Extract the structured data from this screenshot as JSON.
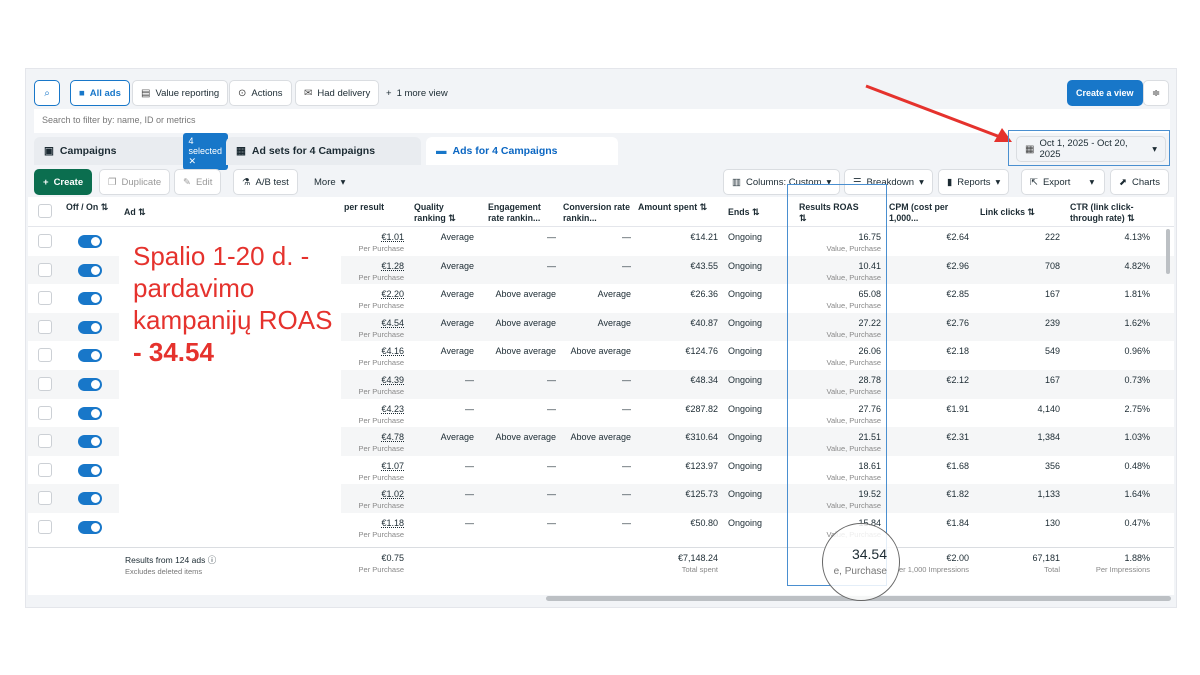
{
  "toolbar": {
    "all_ads": "All ads",
    "value_reporting": "Value reporting",
    "actions": "Actions",
    "had_delivery": "Had delivery",
    "more_view": "1 more view",
    "create_view": "Create a view"
  },
  "search": {
    "placeholder": "Search to filter by: name, ID or metrics"
  },
  "tabs": {
    "campaigns": "Campaigns",
    "selected": "4 selected",
    "adsets": "Ad sets for 4 Campaigns",
    "ads": "Ads for 4 Campaigns"
  },
  "date_range": "Oct 1, 2025 - Oct 20, 2025",
  "actions": {
    "create": "Create",
    "duplicate": "Duplicate",
    "edit": "Edit",
    "ab_test": "A/B test",
    "more": "More",
    "columns": "Columns: Custom",
    "breakdown": "Breakdown",
    "reports": "Reports",
    "export": "Export",
    "charts": "Charts"
  },
  "headers": {
    "offon": "Off / On ⇅",
    "ad": "Ad ⇅",
    "per_result": "per result",
    "quality": "Quality ranking ⇅",
    "engagement": "Engagement rate rankin...",
    "conversion": "Conversion rate rankin...",
    "amount": "Amount spent ⇅",
    "ends": "Ends ⇅",
    "roas": "Results ROAS ⇅",
    "cpm": "CPM (cost per 1,000...",
    "clicks": "Link clicks ⇅",
    "ctr": "CTR (link click-through rate) ⇅"
  },
  "rows": [
    [
      "€1.01",
      "Average",
      "—",
      "—",
      "€14.21",
      "Ongoing",
      "16.75",
      "€2.64",
      "222",
      "4.13%"
    ],
    [
      "€1.28",
      "Average",
      "—",
      "—",
      "€43.55",
      "Ongoing",
      "10.41",
      "€2.96",
      "708",
      "4.82%"
    ],
    [
      "€2.20",
      "Average",
      "Above average",
      "Average",
      "€26.36",
      "Ongoing",
      "65.08",
      "€2.85",
      "167",
      "1.81%"
    ],
    [
      "€4.54",
      "Average",
      "Above average",
      "Average",
      "€40.87",
      "Ongoing",
      "27.22",
      "€2.76",
      "239",
      "1.62%"
    ],
    [
      "€4.16",
      "Average",
      "Above average",
      "Above average",
      "€124.76",
      "Ongoing",
      "26.06",
      "€2.18",
      "549",
      "0.96%"
    ],
    [
      "€4.39",
      "—",
      "—",
      "—",
      "€48.34",
      "Ongoing",
      "28.78",
      "€2.12",
      "167",
      "0.73%"
    ],
    [
      "€4.23",
      "—",
      "—",
      "—",
      "€287.82",
      "Ongoing",
      "27.76",
      "€1.91",
      "4,140",
      "2.75%"
    ],
    [
      "€4.78",
      "Average",
      "Above average",
      "Above average",
      "€310.64",
      "Ongoing",
      "21.51",
      "€2.31",
      "1,384",
      "1.03%"
    ],
    [
      "€1.07",
      "—",
      "—",
      "—",
      "€123.97",
      "Ongoing",
      "18.61",
      "€1.68",
      "356",
      "0.48%"
    ],
    [
      "€1.02",
      "—",
      "—",
      "—",
      "€125.73",
      "Ongoing",
      "19.52",
      "€1.82",
      "1,133",
      "1.64%"
    ],
    [
      "€1.18",
      "—",
      "—",
      "—",
      "€50.80",
      "Ongoing",
      "15.84",
      "€1.84",
      "130",
      "0.47%"
    ]
  ],
  "row_sub": {
    "per_result": "Per Purchase",
    "roas": "Value, Purchase"
  },
  "footer": {
    "results": "Results from 124 ads",
    "excludes": "Excludes deleted items",
    "per_result": "€0.75",
    "per_result_sub": "Per Purchase",
    "amount": "€7,148.24",
    "amount_sub": "Total spent",
    "roas": "34.54",
    "roas_sub": "e, Purchase",
    "cpm": "€2.00",
    "cpm_sub": "er 1,000 Impressions",
    "clicks": "67,181",
    "clicks_sub": "Total",
    "ctr": "1.88%",
    "ctr_sub": "Per Impressions"
  },
  "annotation": {
    "text": "Spalio 1-20 d. - pardavimo kampanijų ROAS",
    "value": "- 34.54"
  },
  "colors": {
    "accent": "#1877c9",
    "create": "#0b6e4f",
    "annotation": "#e5322d"
  }
}
